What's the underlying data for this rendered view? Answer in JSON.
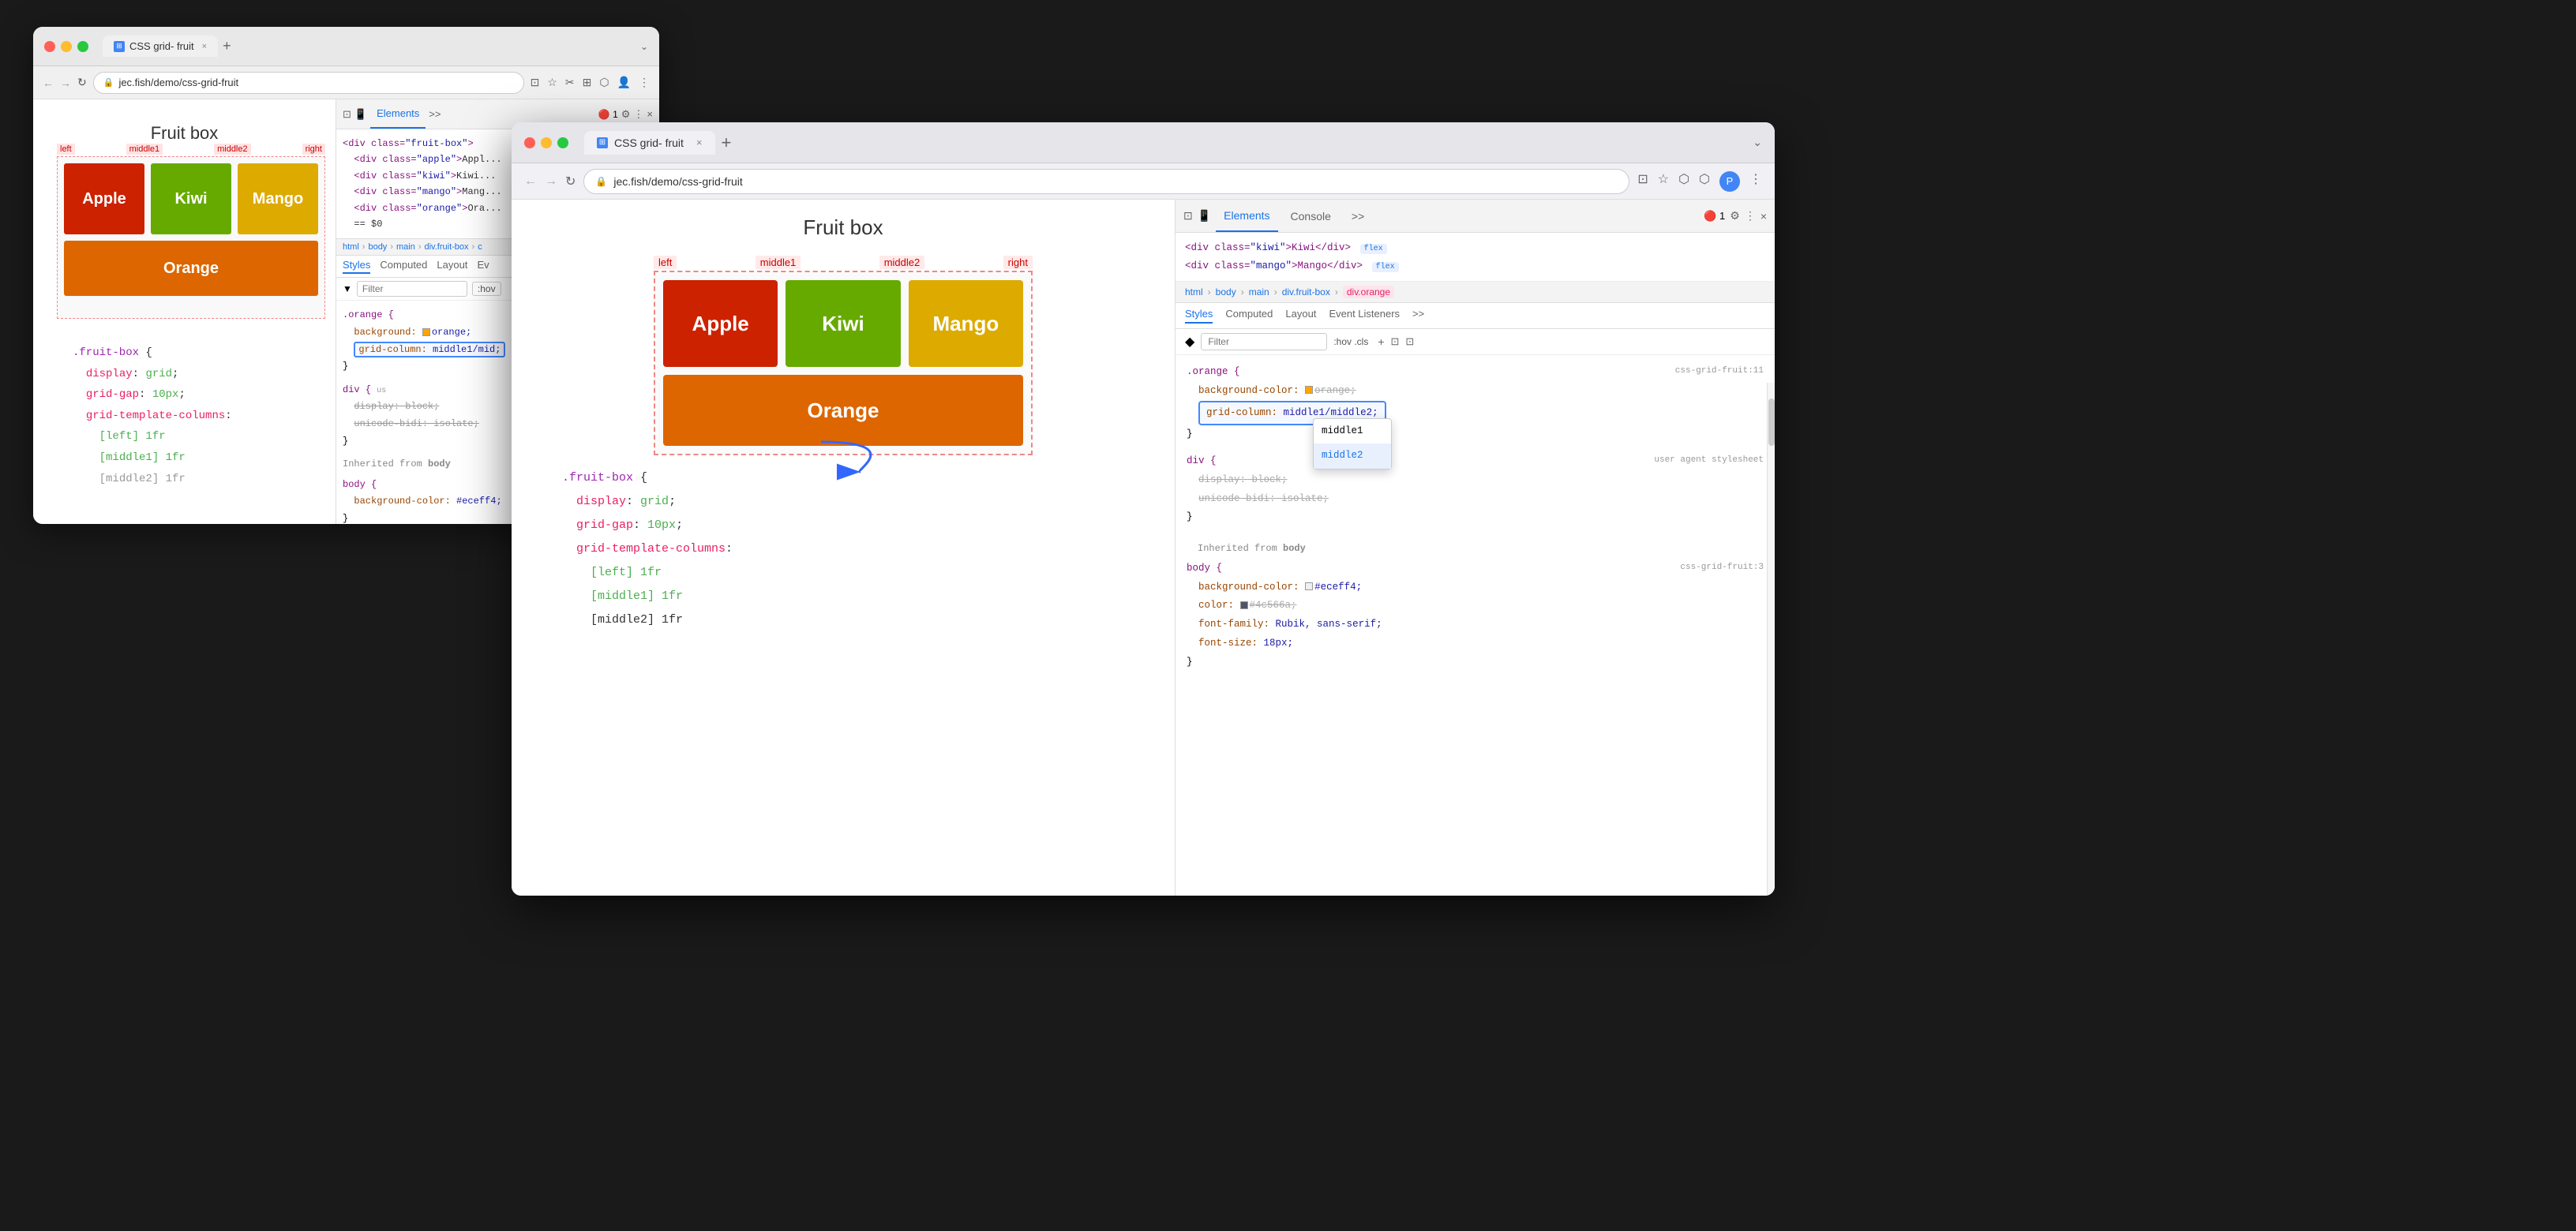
{
  "browser_back": {
    "title": "CSS grid- fruit",
    "url": "jec.fish/demo/css-grid-fruit",
    "tab_close": "×",
    "tab_new": "+",
    "fruit_box_title": "Fruit box",
    "grid_labels": [
      "left",
      "middle1",
      "middle2",
      "right"
    ],
    "fruits": [
      {
        "name": "Apple",
        "class": "apple"
      },
      {
        "name": "Kiwi",
        "class": "kiwi"
      },
      {
        "name": "Mango",
        "class": "mango"
      },
      {
        "name": "Orange",
        "class": "orange"
      }
    ],
    "html_tree": [
      "<div class=\"fruit-box\">",
      "  <div class=\"apple\">Appl...",
      "  <div class=\"kiwi\">Kiwi...",
      "  <div class=\"mango\">Mang...",
      "  <div class=\"orange\">Ora...",
      "  == $0"
    ],
    "breadcrumb": [
      "html",
      "body",
      "main",
      "div.fruit-box",
      "c"
    ],
    "styles_tabs": [
      "Styles",
      "Computed",
      "Layout",
      "Ev"
    ],
    "filter_placeholder": "Filter",
    "css_rules": {
      "orange_selector": ".orange {",
      "orange_bg_prop": "background:",
      "orange_bg_val": "orange;",
      "orange_grid_prop": "grid-column:",
      "orange_grid_val": "middle1/mid;",
      "div_selector": "div {",
      "div_display_prop": "display:",
      "div_display_val": "block;",
      "div_unicode_prop": "unicode-bidi:",
      "div_unicode_val": "isolate;"
    },
    "inherited_from": "Inherited from body",
    "body_rule": "body {",
    "body_bg_prop": "background-color:",
    "body_bg_val": "#eceff4;",
    "code_block": {
      "selector": ".fruit-box {",
      "lines": [
        {
          "prop": "display:",
          "val": "grid;"
        },
        {
          "prop": "grid-gap:",
          "val": "10px;"
        },
        {
          "prop": "grid-template-columns:"
        },
        {
          "indent": "  [left] 1fr"
        },
        {
          "indent": "  [middle1] 1fr"
        },
        {
          "indent": "  [middle2] 1fr"
        }
      ]
    }
  },
  "browser_front": {
    "title": "CSS grid- fruit",
    "url": "jec.fish/demo/css-grid-fruit",
    "tab_close": "×",
    "tab_new": "+",
    "fruit_box_title": "Fruit box",
    "grid_labels": [
      "left",
      "middle1",
      "middle2",
      "right"
    ],
    "fruits": [
      {
        "name": "Apple",
        "class": "apple"
      },
      {
        "name": "Kiwi",
        "class": "kiwi"
      },
      {
        "name": "Mango",
        "class": "mango"
      },
      {
        "name": "Orange",
        "class": "orange"
      }
    ],
    "html_tree": [
      {
        "text": "<div class=\"kiwi\">Kiwi</div>",
        "badge": "flex"
      },
      {
        "text": "<div class=\"mango\">Mango</div>",
        "badge": "flex"
      }
    ],
    "breadcrumb": [
      "html",
      "body",
      "main",
      "div.fruit-box",
      "div.orange"
    ],
    "styles_tabs": [
      "Styles",
      "Computed",
      "Layout",
      "Event Listeners",
      ">>"
    ],
    "filter_placeholder": "Filter",
    "css_rules": {
      "orange_selector": ".orange {",
      "orange_bg_prop": "background-color:",
      "orange_bg_val": "orange;",
      "orange_grid_prop": "grid-column:",
      "orange_grid_val": "middle1/middle2;",
      "orange_grid_source": "css-grid-fruit:11",
      "div_selector": "div {",
      "div_display_prop": "display:",
      "div_display_val": "block;",
      "div_unicode_prop": "unicode-bidi:",
      "div_unicode_val": "isolate;",
      "div_source": "user agent stylesheet"
    },
    "autocomplete": [
      "middle1",
      "middle2"
    ],
    "inherited_from": "Inherited from body",
    "body_rule": "body {",
    "body_bg_prop": "background-color:",
    "body_bg_val": "#eceff4;",
    "body_color_prop": "color:",
    "body_color_val": "#4c566a;",
    "body_ff_prop": "font-family:",
    "body_ff_val": "Rubik, sans-serif;",
    "body_fs_prop": "font-size:",
    "body_fs_val": "18px;",
    "body_source": "css-grid-fruit:3",
    "code_block": {
      "selector": ".fruit-box {",
      "lines": [
        {
          "prop": "display:",
          "val": "grid;"
        },
        {
          "prop": "grid-gap:",
          "val": "10px;"
        },
        {
          "prop": "grid-template-columns:"
        },
        {
          "indent": "  [left] 1fr"
        },
        {
          "indent": "  [middle1] 1fr"
        },
        {
          "indent": "  [middle2] 1fr"
        }
      ]
    }
  }
}
